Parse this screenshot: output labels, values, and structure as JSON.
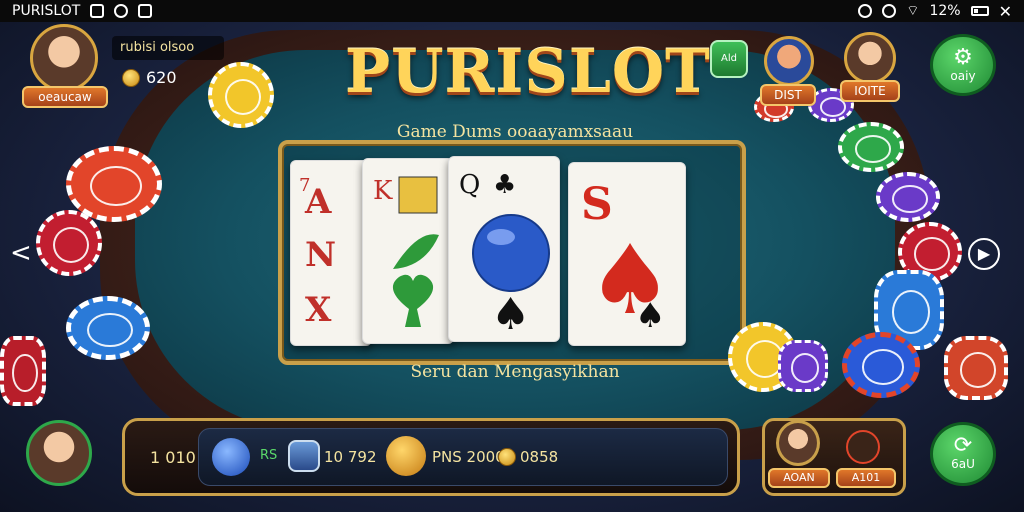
{
  "statusbar": {
    "app_name": "PURISLOT",
    "battery": "12%"
  },
  "game": {
    "logo": "PURISLOT",
    "subtitle": "Game Dums ooaayamxsaau",
    "tagline": "Seru dan Mengasyikhan"
  },
  "player": {
    "name": "rubisi olsoo",
    "coins": "620",
    "nameplate": "oeaucaw"
  },
  "ad_button": {
    "label": "Ald"
  },
  "opponents": [
    {
      "nameplate": "DIST"
    },
    {
      "nameplate": "IOITE"
    }
  ],
  "right_buttons": {
    "top_label": "oaiy",
    "bottom_label": "6aU"
  },
  "bottom_bar": {
    "level": "1 010",
    "stat_a": "RS",
    "stat_b": "10 792",
    "stat_c": "PNS 2000",
    "stat_d": "0858"
  },
  "bottom_right_panel": {
    "nameplate_left": "AOAN",
    "nameplate_right": "A101"
  },
  "colors": {
    "gold": "#c9a04a",
    "felt": "#145060",
    "logo": "#ffd45a",
    "green_button": "#2aa63e"
  },
  "icons": [
    "back-chevron-icon",
    "forward-play-icon",
    "coin-icon",
    "globe-icon",
    "pointer-icon"
  ]
}
